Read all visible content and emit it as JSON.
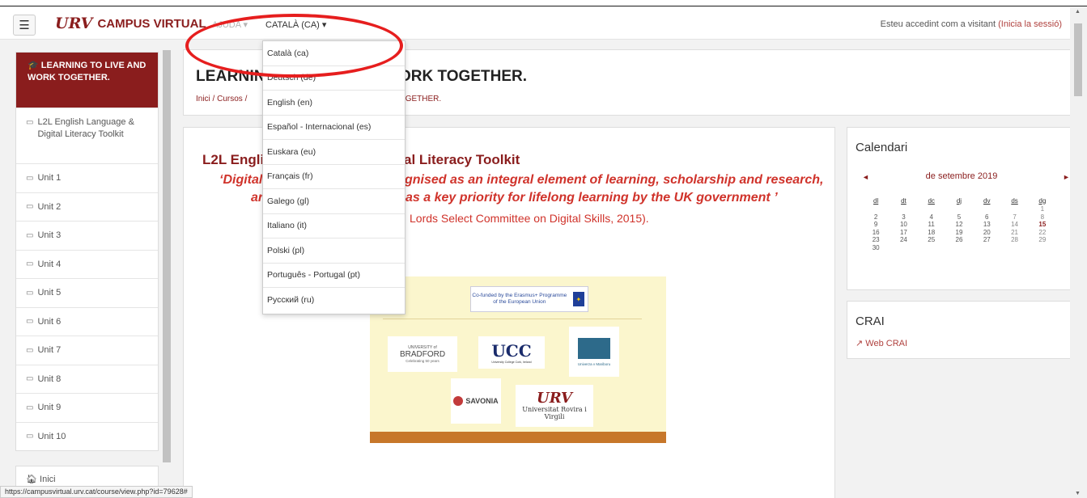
{
  "navbar": {
    "menu_icon": "hamburger-icon",
    "brand_logo": "URV",
    "brand": "CAMPUS VIRTUAL",
    "help": "AJUDA",
    "language": "CATALÀ (CA)",
    "visitor_text": "Esteu accedint com a visitant",
    "login_link": "(Inicia la sessió)"
  },
  "sidebar": {
    "active": "LEARNING TO LIVE AND WORK TOGETHER.",
    "items": [
      {
        "label": "L2L English Language & Digital Literacy Toolkit"
      },
      {
        "label": "Unit 1"
      },
      {
        "label": "Unit 2"
      },
      {
        "label": "Unit 3"
      },
      {
        "label": "Unit 4"
      },
      {
        "label": "Unit 5"
      },
      {
        "label": "Unit 6"
      },
      {
        "label": "Unit 7"
      },
      {
        "label": "Unit 8"
      },
      {
        "label": "Unit 9"
      },
      {
        "label": "Unit 10"
      }
    ],
    "home": "Inici"
  },
  "header": {
    "title_visible": "LEARNIN",
    "title_tail": "ORK TOGETHER.",
    "breadcrumb_visible": "Inici / Cursos /",
    "breadcrumb_tail": "TOGETHER."
  },
  "main": {
    "heading_visible": "L2L Engli",
    "heading_tail": "al Literacy Toolkit",
    "quote1_visible": "‘Digital",
    "quote1_tail": "gnised as an integral element of learning, scholarship and research,",
    "quote2_visible": "ar",
    "quote2_tail": "as a key priority for lifelong learning by the UK government ’",
    "source_tail": "Lords Select Committee on Digital Skills, 2015).",
    "logos": {
      "erasmus": "Co-funded by the Erasmus+ Programme of the European Union",
      "bradford_small": "UNIVERSITY of",
      "bradford": "BRADFORD",
      "bradford_sub": "Celebrating 50 years",
      "ucc": "UCC",
      "ucc_sub": "University College Cork, Ireland",
      "maribor": "Univerza v Mariboru",
      "savonia": "SAVONIA",
      "urv_mark": "URV",
      "urv": "Universitat Rovira i Virgili"
    }
  },
  "calendar": {
    "title": "Calendari",
    "prev": "◄",
    "next": "►",
    "month": "de setembre 2019",
    "weekdays": [
      "dl",
      "dt",
      "dc",
      "dj",
      "dv",
      "ds",
      "dg"
    ],
    "weeks": [
      [
        "",
        "",
        "",
        "",
        "",
        "",
        "1"
      ],
      [
        "2",
        "3",
        "4",
        "5",
        "6",
        "7",
        "8"
      ],
      [
        "9",
        "10",
        "11",
        "12",
        "13",
        "14",
        "15"
      ],
      [
        "16",
        "17",
        "18",
        "19",
        "20",
        "21",
        "22"
      ],
      [
        "23",
        "24",
        "25",
        "26",
        "27",
        "28",
        "29"
      ],
      [
        "30",
        "",
        "",
        "",
        "",
        "",
        ""
      ]
    ],
    "today": "15"
  },
  "crai": {
    "title": "CRAI",
    "link": "Web CRAI",
    "link_icon": "external-link-icon"
  },
  "dropdown": {
    "options": [
      "Català (ca)",
      "Deutsch (de)",
      "English (en)",
      "Español - Internacional (es)",
      "Euskara (eu)",
      "Français (fr)",
      "Galego (gl)",
      "Italiano (it)",
      "Polski (pl)",
      "Português - Portugal (pt)",
      "Русский (ru)"
    ]
  },
  "statusbar": {
    "url": "https://campusvirtual.urv.cat/course/view.php?id=79628#"
  },
  "colors": {
    "brand": "#8a1d1d",
    "accent_red": "#d0332b",
    "annotation": "#e61e1e"
  }
}
